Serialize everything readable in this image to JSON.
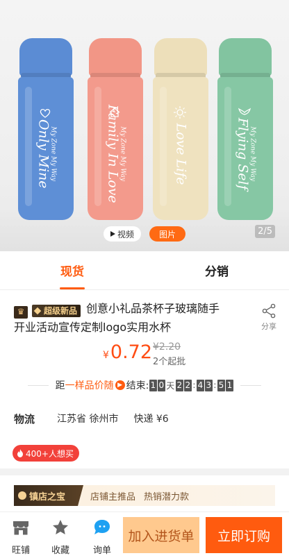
{
  "hero": {
    "bottles": [
      {
        "color": "#5e8fd6",
        "small_text": "My Zone My Way",
        "big_text": "Only Mine"
      },
      {
        "color": "#f39a8c",
        "small_text": "My Zone My Way",
        "big_text": "Family In Love"
      },
      {
        "color": "#efe2bf",
        "small_text": "",
        "big_text": "Love Life"
      },
      {
        "color": "#86c7a4",
        "small_text": "My Zone My Way",
        "big_text": "Flying Self"
      }
    ],
    "video_label": "视频",
    "image_label": "图片",
    "counter": "2/5"
  },
  "tabs": [
    {
      "label": "现货",
      "active": true
    },
    {
      "label": "分销",
      "active": false
    }
  ],
  "product": {
    "badge_crown": "♛",
    "badge_super": "超级新品",
    "title_line1": "创意小礼品茶杯子玻璃随手",
    "title_line2": "开业活动宣传定制logo实用水杯",
    "share_label": "分享",
    "currency": "¥",
    "price": "0.72",
    "original_price": "¥2.20",
    "moq": "2个起批"
  },
  "countdown": {
    "prefix": "距",
    "highlight": "一样品价随",
    "suffix": "结束:",
    "days": "10",
    "day_unit": "天",
    "hours": "22",
    "minutes": "43",
    "seconds": "51"
  },
  "logistics": {
    "label": "物流",
    "origin": "江苏省 徐州市",
    "shipping": "快递 ¥6"
  },
  "hot_tag": "400+人想买",
  "treasure": {
    "tag": "镇店之宝",
    "text1": "店铺主推品",
    "text2": "热销潜力款"
  },
  "bottom_bar": {
    "shop_label": "旺铺",
    "favorite_label": "收藏",
    "inquiry_label": "询单",
    "add_cart_label": "加入进货单",
    "buy_label": "立即订购"
  },
  "colors": {
    "accent": "#ff5b0f",
    "price": "#ff4d14",
    "cart_button": "#ffc98e",
    "hot_tag": "#f2413a"
  }
}
